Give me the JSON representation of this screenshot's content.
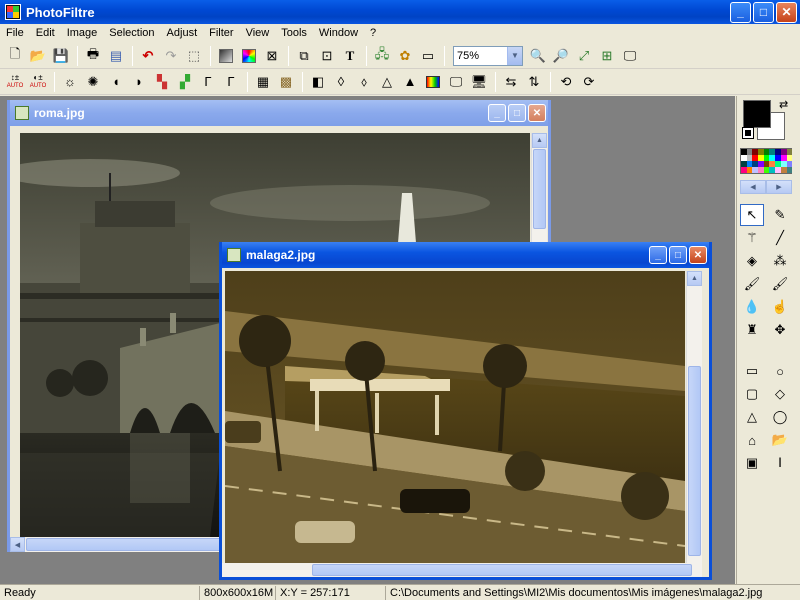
{
  "app": {
    "title": "PhotoFiltre",
    "minimize": "_",
    "maximize": "□",
    "close": "✕"
  },
  "menu": [
    "File",
    "Edit",
    "Image",
    "Selection",
    "Adjust",
    "Filter",
    "View",
    "Tools",
    "Window",
    "?"
  ],
  "toolbar1": {
    "icons": [
      "new-file-icon",
      "open-folder-icon",
      "save-icon",
      "print-icon",
      "scan-icon",
      "undo-icon",
      "redo-icon",
      "crop-icon",
      "grayscale-icon",
      "palette-icon",
      "effects-icon",
      "resize-image-icon",
      "canvas-size-icon",
      "text-icon",
      "tree-icon",
      "explorer-icon",
      "zoom-window-icon"
    ],
    "zoom_value": "75%",
    "zoom_icons": [
      "zoom-in-icon",
      "zoom-out-icon",
      "fit-icon",
      "actual-size-icon",
      "fullscreen-icon"
    ]
  },
  "toolbar2": {
    "auto_label": "AUTO"
  },
  "windows": {
    "roma": {
      "title": "roma.jpg"
    },
    "malaga": {
      "title": "malaga2.jpg"
    }
  },
  "palette": {
    "foreground": "#000000",
    "background": "#ffffff",
    "swatches": [
      "#000000",
      "#808080",
      "#800000",
      "#808000",
      "#008000",
      "#008080",
      "#000080",
      "#800080",
      "#808040",
      "#ffffff",
      "#c0c0c0",
      "#ff0000",
      "#ffff00",
      "#00ff00",
      "#00ffff",
      "#0000ff",
      "#ff00ff",
      "#ffff80",
      "#004040",
      "#0080ff",
      "#004080",
      "#8000ff",
      "#804000",
      "#ff8040",
      "#00ff80",
      "#80ffff",
      "#8080ff",
      "#ff0080",
      "#ff8000",
      "#c0c0ff",
      "#ff80c0",
      "#40ff00",
      "#00c0c0",
      "#ffc0ff",
      "#c08040",
      "#408080"
    ],
    "tools": [
      "pointer-tool-icon",
      "eyedropper-tool-icon",
      "magic-wand-tool-icon",
      "line-tool-icon",
      "fill-tool-icon",
      "spray-tool-icon",
      "brush-tool-icon",
      "advanced-brush-tool-icon",
      "blur-tool-icon",
      "smudge-tool-icon",
      "stamp-tool-icon",
      "clone-tool-icon"
    ],
    "shapes": [
      "rectangle-select-icon",
      "ellipse-select-icon",
      "rounded-rect-select-icon",
      "diamond-select-icon",
      "triangle-select-icon",
      "lasso-select-icon",
      "polygon-select-icon",
      "open-folder-select-icon",
      "selection-mode-icon",
      "text-select-icon"
    ]
  },
  "status": {
    "ready": "Ready",
    "dimensions": "800x600x16M",
    "coords": "X:Y = 257:171",
    "path": "C:\\Documents and Settings\\MI2\\Mis documentos\\Mis imágenes\\malaga2.jpg"
  }
}
